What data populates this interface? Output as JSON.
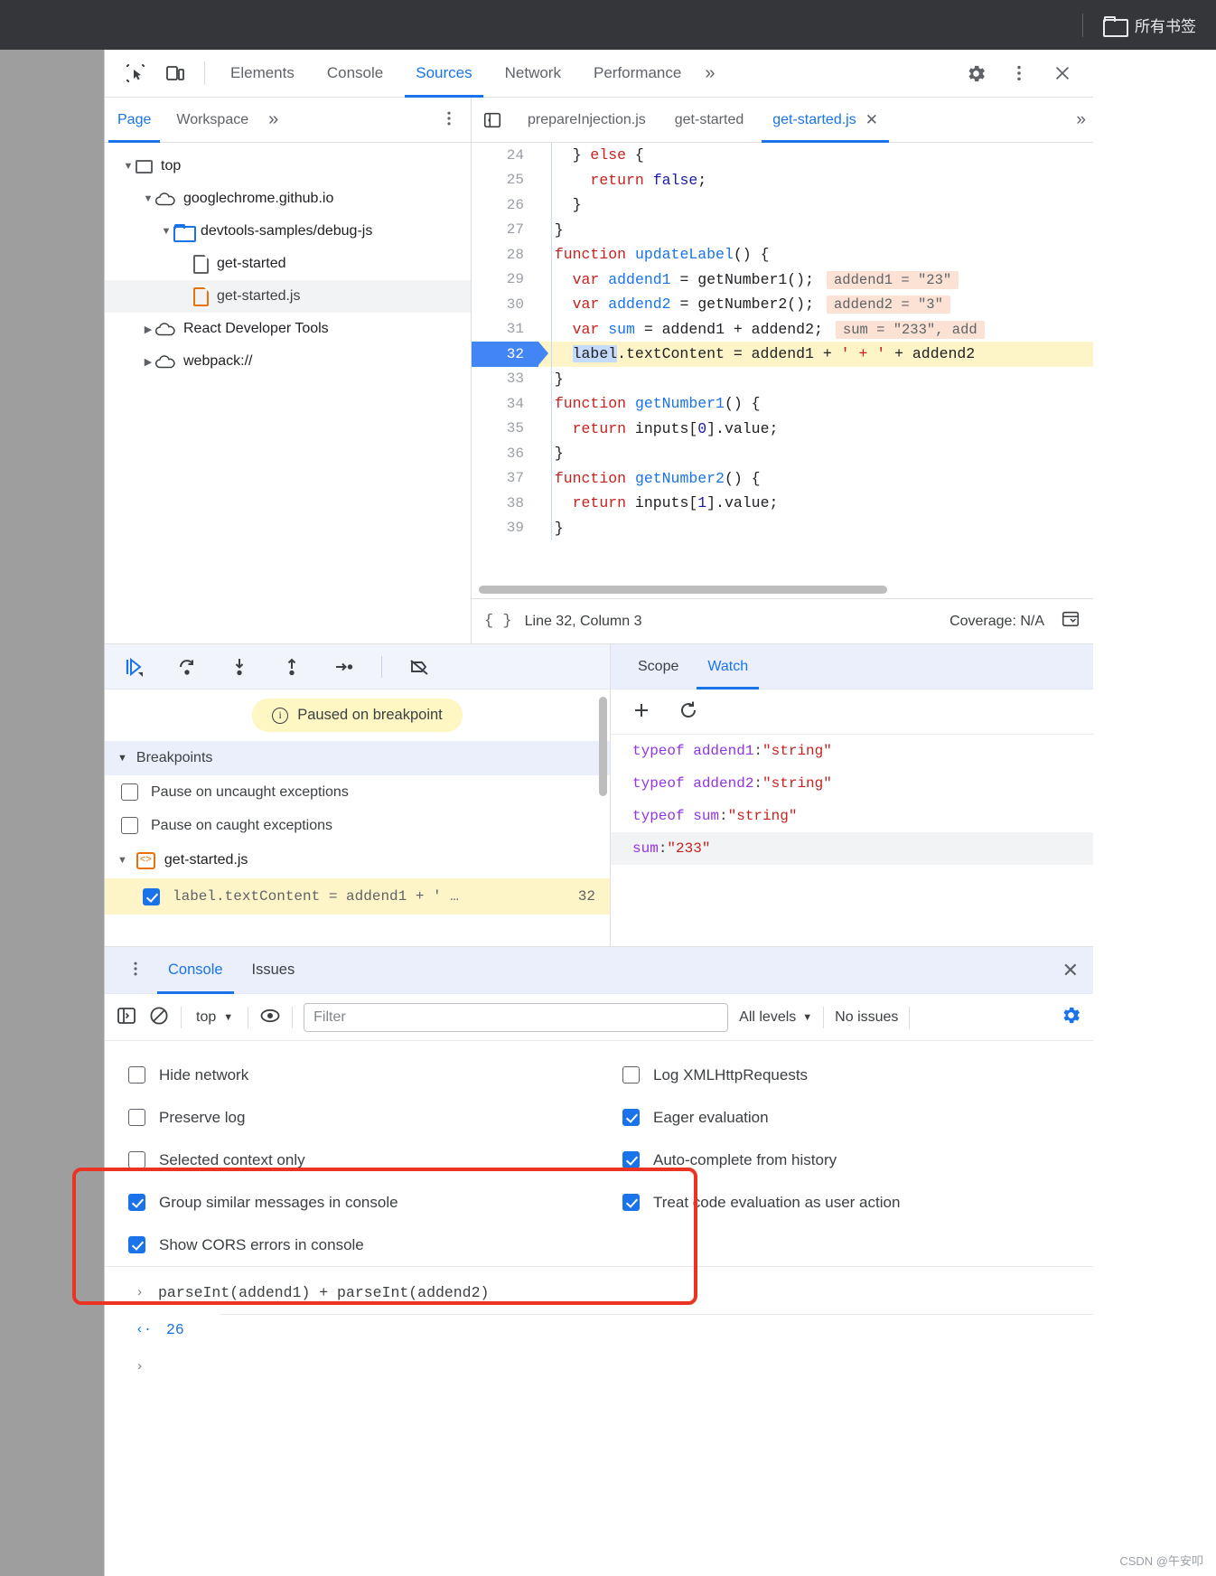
{
  "browser": {
    "bookmarks_label": "所有书签",
    "folder_icon": "folder-icon"
  },
  "devtools": {
    "main_tabs": [
      {
        "label": "Elements",
        "active": false
      },
      {
        "label": "Console",
        "active": false
      },
      {
        "label": "Sources",
        "active": true
      },
      {
        "label": "Network",
        "active": false
      },
      {
        "label": "Performance",
        "active": false
      }
    ],
    "more_tabs_icon": "chevron-double-right-icon",
    "settings_icon": "gear-icon",
    "menu_icon": "vertical-dots-icon",
    "close_icon": "close-icon",
    "inspect_icon": "inspect-element-icon",
    "device_icon": "device-toolbar-icon"
  },
  "navigator": {
    "tabs": [
      {
        "label": "Page",
        "active": true
      },
      {
        "label": "Workspace",
        "active": false
      }
    ],
    "overflow_icon": "chevron-double-right-icon",
    "more_icon": "vertical-dots-icon",
    "tree": [
      {
        "label": "top",
        "icon": "frame-icon",
        "twist": "▼",
        "indent": 0,
        "selected": false
      },
      {
        "label": "googlechrome.github.io",
        "icon": "cloud-icon",
        "twist": "▼",
        "indent": 1,
        "selected": false
      },
      {
        "label": "devtools-samples/debug-js",
        "icon": "folder-icon",
        "twist": "▼",
        "indent": 2,
        "selected": false
      },
      {
        "label": "get-started",
        "icon": "document-icon",
        "twist": "",
        "indent": 3,
        "selected": false
      },
      {
        "label": "get-started.js",
        "icon": "js-document-icon",
        "twist": "",
        "indent": 3,
        "selected": true
      },
      {
        "label": "React Developer Tools",
        "icon": "cloud-icon",
        "twist": "▶",
        "indent": 1,
        "selected": false
      },
      {
        "label": "webpack://",
        "icon": "cloud-icon",
        "twist": "▶",
        "indent": 1,
        "selected": false
      }
    ]
  },
  "editor": {
    "panel_toggle_icon": "show-navigator-icon",
    "tabs": [
      {
        "label": "prepareInjection.js",
        "active": false,
        "closable": false
      },
      {
        "label": "get-started",
        "active": false,
        "closable": false
      },
      {
        "label": "get-started.js",
        "active": true,
        "closable": true
      }
    ],
    "overflow_icon": "chevron-double-right-icon",
    "code_lines": [
      {
        "num": "24",
        "exec": false,
        "html": "    } <span class=\"kw\">else</span> {"
      },
      {
        "num": "25",
        "exec": false,
        "html": "      <span class=\"kw\">return</span> <span class=\"kw2\">false</span>;"
      },
      {
        "num": "26",
        "exec": false,
        "html": "    }"
      },
      {
        "num": "27",
        "exec": false,
        "html": "  }"
      },
      {
        "num": "28",
        "exec": false,
        "html": "  <span class=\"kw\">function</span> <span class=\"fname\">updateLabel</span>() {"
      },
      {
        "num": "29",
        "exec": false,
        "html": "    <span class=\"kw\">var</span> <span class=\"fname\">addend1</span> = getNumber1();<span class=\"ival\">addend1 = \"23\"</span>"
      },
      {
        "num": "30",
        "exec": false,
        "html": "    <span class=\"kw\">var</span> <span class=\"fname\">addend2</span> = getNumber2();<span class=\"ival\">addend2 = \"3\"</span>"
      },
      {
        "num": "31",
        "exec": false,
        "html": "    <span class=\"kw\">var</span> <span class=\"fname\">sum</span> = addend1 + addend2;<span class=\"ival\">sum = \"233\", add</span>"
      },
      {
        "num": "32",
        "exec": true,
        "html": "    <span class=\"sel-tok\">label</span>.textContent = addend1 + <span class=\"str\">' + '</span> + addend2"
      },
      {
        "num": "33",
        "exec": false,
        "html": "  }"
      },
      {
        "num": "34",
        "exec": false,
        "html": "  <span class=\"kw\">function</span> <span class=\"fname\">getNumber1</span>() {"
      },
      {
        "num": "35",
        "exec": false,
        "html": "    <span class=\"kw\">return</span> inputs[<span class=\"num\">0</span>].value;"
      },
      {
        "num": "36",
        "exec": false,
        "html": "  }"
      },
      {
        "num": "37",
        "exec": false,
        "html": "  <span class=\"kw\">function</span> <span class=\"fname\">getNumber2</span>() {"
      },
      {
        "num": "38",
        "exec": false,
        "html": "    <span class=\"kw\">return</span> inputs[<span class=\"num\">1</span>].value;"
      },
      {
        "num": "39",
        "exec": false,
        "html": "  }"
      }
    ],
    "status": {
      "brace_icon": "pretty-print-icon",
      "position": "Line 32, Column 3",
      "coverage": "Coverage: N/A",
      "right_icon": "console-drawer-icon"
    }
  },
  "debugger": {
    "toolbar_icons": [
      "resume-script-icon",
      "step-over-icon",
      "step-into-icon",
      "step-out-icon",
      "step-icon",
      "deactivate-breakpoints-icon"
    ],
    "paused_message": "Paused on breakpoint",
    "paused_icon": "info-icon",
    "breakpoints_header": "Breakpoints",
    "breakpoints_twist": "▼",
    "options": [
      {
        "label": "Pause on uncaught exceptions",
        "checked": false
      },
      {
        "label": "Pause on caught exceptions",
        "checked": false
      }
    ],
    "file_group": {
      "label": "get-started.js",
      "twist": "▼",
      "icon": "js-file-icon"
    },
    "breakpoint_item": {
      "checked": true,
      "code": "label.textContent = addend1 + '  …",
      "line": "32"
    }
  },
  "sidepane": {
    "tabs": [
      {
        "label": "Scope",
        "active": false
      },
      {
        "label": "Watch",
        "active": true
      }
    ],
    "add_icon": "plus-icon",
    "refresh_icon": "refresh-icon",
    "watch_items": [
      {
        "name": "typeof addend1",
        "value": "\"string\"",
        "highlight": false
      },
      {
        "name": "typeof addend2",
        "value": "\"string\"",
        "highlight": false
      },
      {
        "name": "typeof sum",
        "value": "\"string\"",
        "highlight": false
      },
      {
        "name": "sum ",
        "value": "\"233\"",
        "highlight": true
      }
    ]
  },
  "drawer": {
    "menu_icon": "vertical-dots-icon",
    "tabs": [
      {
        "label": "Console",
        "active": true
      },
      {
        "label": "Issues",
        "active": false
      }
    ],
    "close_icon": "close-icon",
    "toolbar": {
      "sidebar_icon": "console-sidebar-icon",
      "clear_icon": "clear-console-icon",
      "context": "top",
      "context_caret": "▼",
      "eye_icon": "live-expression-icon",
      "filter_placeholder": "Filter",
      "filter_value": "",
      "levels": "All levels",
      "levels_caret": "▼",
      "issues": "No issues",
      "gear_icon": "gear-icon"
    },
    "settings": [
      {
        "label": "Hide network",
        "checked": false
      },
      {
        "label": "Log XMLHttpRequests",
        "checked": false
      },
      {
        "label": "Preserve log",
        "checked": false
      },
      {
        "label": "Eager evaluation",
        "checked": true
      },
      {
        "label": "Selected context only",
        "checked": false
      },
      {
        "label": "Auto-complete from history",
        "checked": true
      },
      {
        "label": "Group similar messages in console",
        "checked": true
      },
      {
        "label": "Treat code evaluation as user action",
        "checked": true
      },
      {
        "label": "Show CORS errors in console",
        "checked": true
      }
    ],
    "output": {
      "input_arrow": "›",
      "input_expression": "parseInt(addend1) + parseInt(addend2)",
      "result_arrow": "‹·",
      "result_value": "26",
      "prompt_arrow": "›"
    }
  },
  "annotation": {
    "highlight_color": "#ea3323"
  },
  "watermark": "CSDN @午安叩"
}
